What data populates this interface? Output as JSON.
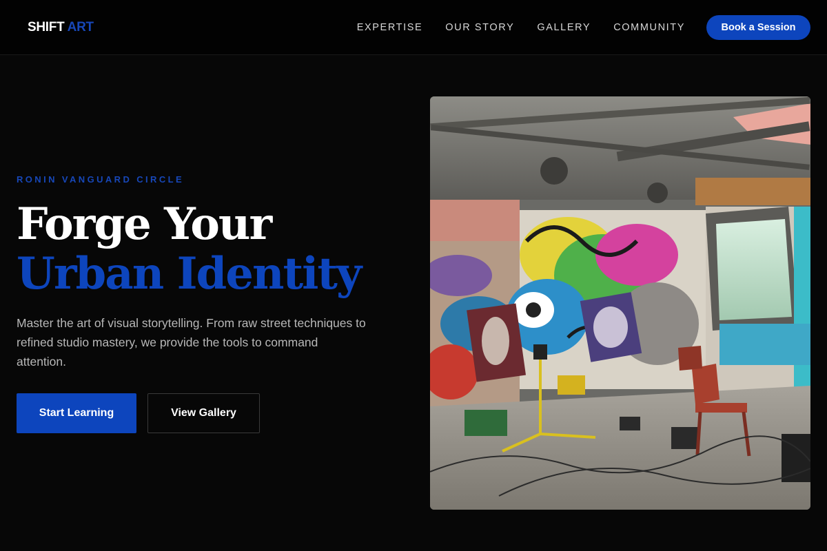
{
  "header": {
    "logo_main": "SHIFT",
    "logo_accent": "ART",
    "nav": [
      "EXPERTISE",
      "OUR STORY",
      "GALLERY",
      "COMMUNITY"
    ],
    "cta_label": "Book a Session"
  },
  "hero": {
    "eyebrow": "RONIN VANGUARD CIRCLE",
    "headline_line1": "Forge Your",
    "headline_line2": "Urban Identity",
    "lead": "Master the art of visual storytelling. From raw street techniques to refined studio mastery, we provide the tools to command attention.",
    "primary_button": "Start Learning",
    "secondary_button": "View Gallery"
  },
  "colors": {
    "accent": "#0d45bd",
    "background": "#070707",
    "text": "#ffffff",
    "muted_text": "#b8b8b8"
  }
}
